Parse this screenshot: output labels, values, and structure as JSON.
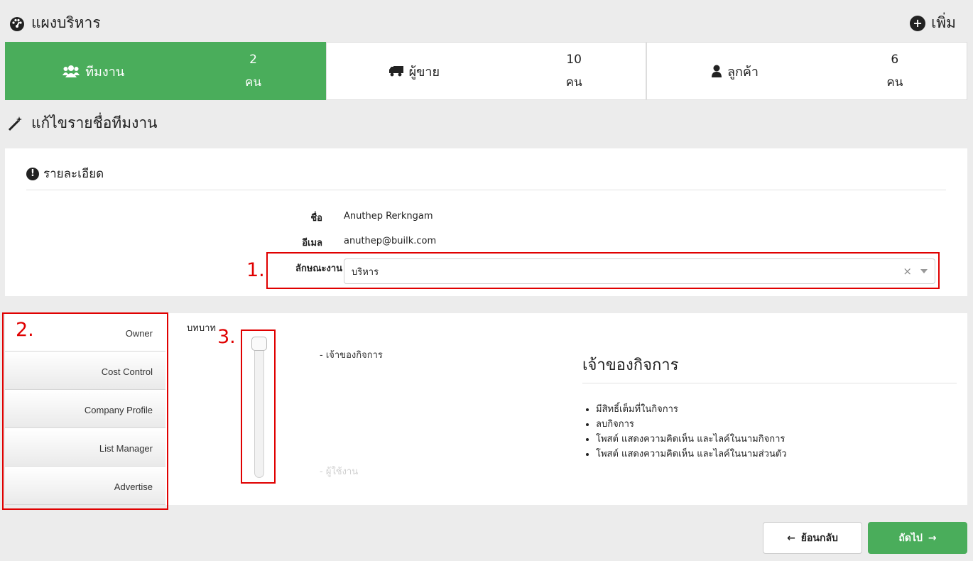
{
  "header": {
    "title": "แผงบริหาร",
    "title_icon": "dashboard-icon",
    "add_label": "เพิ่ม",
    "add_icon": "plus-circle-icon"
  },
  "stats": [
    {
      "label": "ทีมงาน",
      "icon": "users-icon",
      "count": "2",
      "unit": "คน",
      "active": true
    },
    {
      "label": "ผู้ขาย",
      "icon": "truck-icon",
      "count": "10",
      "unit": "คน",
      "active": false
    },
    {
      "label": "ลูกค้า",
      "icon": "user-icon",
      "count": "6",
      "unit": "คน",
      "active": false
    }
  ],
  "section": {
    "title": "แก้ไขรายชื่อทีมงาน",
    "icon": "magic-wand-icon"
  },
  "details": {
    "title": "รายละเอียด",
    "title_icon": "exclamation-circle-icon",
    "name_label": "ชื่อ",
    "name_value": "Anuthep Rerkngam",
    "email_label": "อีเมล",
    "email_value": "anuthep@builk.com",
    "jobtype_label": "ลักษณะงาน",
    "jobtype_value": "บริหาร",
    "clear_glyph": "×"
  },
  "annotations": {
    "one": "1.",
    "two": "2.",
    "three": "3."
  },
  "roles": {
    "tabs": [
      "Owner",
      "Cost Control",
      "Company Profile",
      "List Manager",
      "Advertise"
    ],
    "active_tab": 0,
    "role_label": "บทบาท",
    "slider_top_label": "- เจ้าของกิจการ",
    "slider_bottom_label": "- ผู้ใช้งาน",
    "slider_level": 1.0,
    "desc_title": "เจ้าของกิจการ",
    "desc_items": [
      "มีสิทธิ์เต็มที่ในกิจการ",
      "ลบกิจการ",
      "โพสต์ แสดงความคิดเห็น และไลค์ในนามกิจการ",
      "โพสต์ แสดงความคิดเห็น และไลค์ในนามส่วนตัว"
    ]
  },
  "buttons": {
    "back_label": "ย้อนกลับ",
    "back_icon": "arrow-left-icon",
    "next_label": "ถัดไป",
    "next_icon": "arrow-right-icon"
  },
  "colors": {
    "accent": "#4aad5b",
    "annotation": "#e00000"
  }
}
